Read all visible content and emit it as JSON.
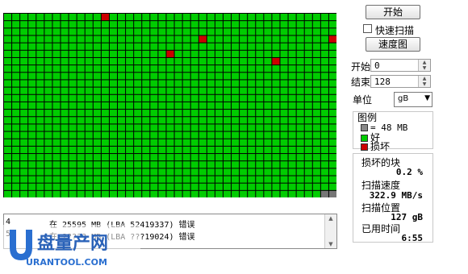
{
  "colors": {
    "good": "#00cc00",
    "bad": "#cc0000",
    "unscanned": "#777777",
    "cell_gap": "#000000"
  },
  "surface_scan": {
    "columns": 41,
    "rows": 25,
    "bad_blocks": [
      {
        "col": 12,
        "row": 0
      },
      {
        "col": 24,
        "row": 3
      },
      {
        "col": 40,
        "row": 3
      },
      {
        "col": 20,
        "row": 5
      },
      {
        "col": 33,
        "row": 6
      }
    ],
    "unscanned_blocks": [
      {
        "col": 39,
        "row": 24
      },
      {
        "col": 40,
        "row": 24
      }
    ]
  },
  "controls": {
    "start_button": "开始",
    "quick_scan_label": "快速扫描",
    "quick_scan_checked": false,
    "speed_map_button": "速度图",
    "start_label": "开始",
    "start_value": "0",
    "end_label": "结束",
    "end_value": "128",
    "unit_label": "单位",
    "unit_value": "gB"
  },
  "legend": {
    "title": "图例",
    "block_size": "= 48 MB",
    "good_label": "好",
    "bad_label": "损坏"
  },
  "stats": {
    "damaged_label": "损坏的块",
    "damaged_value": "0.2 %",
    "speed_label": "扫描速度",
    "speed_value": "322.9 MB/s",
    "position_label": "扫描位置",
    "position_value": "127 gB",
    "elapsed_label": "已用时间",
    "elapsed_value": "6:55"
  },
  "log": {
    "lines": [
      {
        "index": "4",
        "text": "在 25595 MB (LBA 52419337) 错误"
      },
      {
        "index": "5",
        "text": "在 ????? MB (LBA ???19024) 错误"
      }
    ]
  },
  "watermark": {
    "brand": "盘量产网",
    "url": "URANTOOL.COM",
    "letter": "U"
  }
}
